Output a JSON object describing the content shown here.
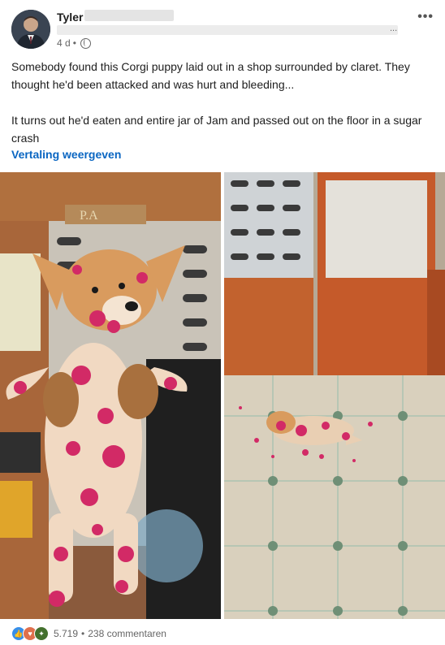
{
  "post": {
    "author": "Tyler",
    "time": "4 d",
    "bullet": "•",
    "subtitle_end": "...",
    "paragraphs": [
      "Somebody found this Corgi puppy laid out in a shop surrounded by claret. They thought he'd been attacked and was hurt and bleeding...",
      "It turns out he'd eaten and entire jar of Jam and passed out on the floor in a sugar crash"
    ],
    "translate_label": "Vertaling weergeven",
    "more_label": "•••"
  },
  "icons": {
    "more": "more-options-icon",
    "visibility": "globe-icon",
    "like": "like-reaction-icon",
    "love": "love-reaction-icon",
    "celebrate": "celebrate-reaction-icon"
  },
  "images": [
    {
      "name": "corgi-held-photo",
      "description_visible": false
    },
    {
      "name": "corgi-on-floor-photo",
      "description_visible": false
    }
  ],
  "social": {
    "reaction_count": "5.719",
    "separator": "•",
    "comments": "238 commentaren"
  },
  "colors": {
    "link": "#0a66c2",
    "like": "#378fe9",
    "love": "#df704d",
    "celebrate": "#44712e",
    "jam": "#d22a66"
  }
}
